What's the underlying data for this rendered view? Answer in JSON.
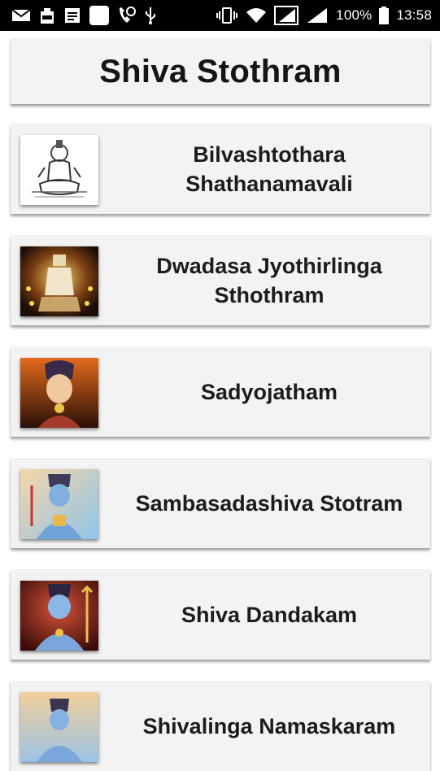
{
  "status_bar": {
    "battery": "100%",
    "time": "13:58"
  },
  "header": {
    "title": "Shiva Stothram"
  },
  "items": [
    {
      "title": "Bilvashtothara Shathanamavali",
      "thumbnail": "shiva-sketch-image"
    },
    {
      "title": "Dwadasa Jyothirlinga Sthothram",
      "thumbnail": "shiva-lamps-image"
    },
    {
      "title": "Sadyojatham",
      "thumbnail": "shiva-portrait-image"
    },
    {
      "title": "Sambasadashiva Stotram",
      "thumbnail": "shiva-blue-image"
    },
    {
      "title": "Shiva Dandakam",
      "thumbnail": "shiva-red-image"
    },
    {
      "title": "Shivalinga Namaskaram",
      "thumbnail": "shiva-sky-image"
    }
  ]
}
